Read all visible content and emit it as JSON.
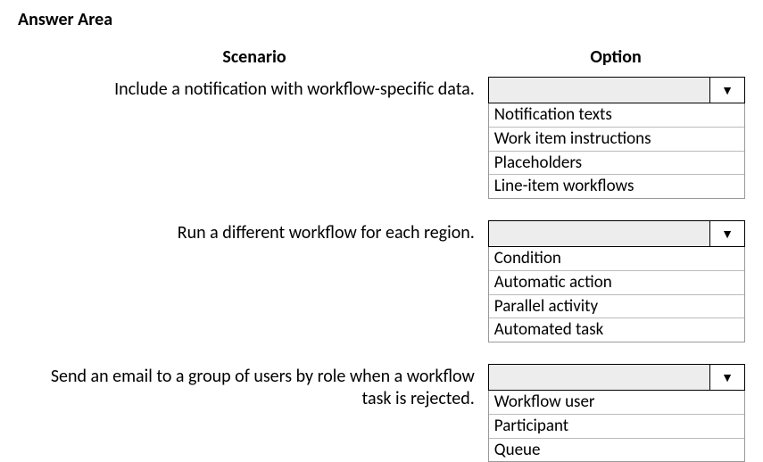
{
  "title": "Answer Area",
  "headers": {
    "scenario": "Scenario",
    "option": "Option"
  },
  "rows": [
    {
      "scenario": "Include a notification with workflow-specific data.",
      "selected": "",
      "options": [
        "Notification texts",
        "Work item instructions",
        "Placeholders",
        "Line-item workflows"
      ]
    },
    {
      "scenario": "Run a different workflow for each region.",
      "selected": "",
      "options": [
        "Condition",
        "Automatic action",
        "Parallel activity",
        "Automated task"
      ]
    },
    {
      "scenario": "Send an email to a group of users by role when a workflow  task is rejected.",
      "selected": "",
      "options": [
        "Workflow user",
        "Participant",
        "Queue"
      ]
    }
  ]
}
